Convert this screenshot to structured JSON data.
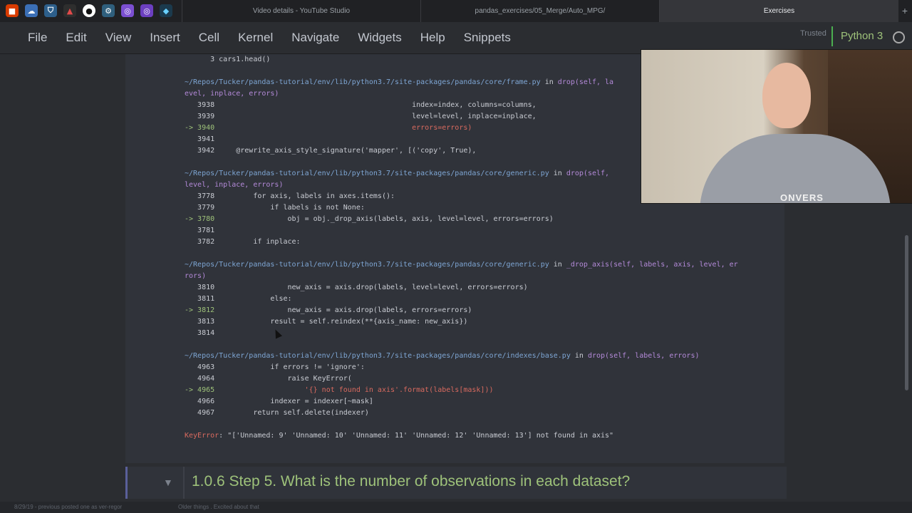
{
  "browser": {
    "tabs": [
      {
        "label": "Video details - YouTube Studio",
        "active": false
      },
      {
        "label": "pandas_exercises/05_Merge/Auto_MPG/",
        "active": false
      },
      {
        "label": "Exercises",
        "active": true
      }
    ],
    "extension_icons": [
      "office-icon",
      "cloud-icon",
      "shield-icon",
      "anaconda-icon",
      "github-icon",
      "python-icon",
      "notion-icon",
      "obsidian-icon",
      "diamond-icon"
    ],
    "new_tab": "+"
  },
  "menubar": {
    "items": [
      "File",
      "Edit",
      "View",
      "Insert",
      "Cell",
      "Kernel",
      "Navigate",
      "Widgets",
      "Help",
      "Snippets"
    ],
    "trusted": "Trusted",
    "kernel": "Python 3"
  },
  "traceback": {
    "line0": "      3 cars1.head()",
    "f1_path": "~/Repos/Tucker/pandas-tutorial/env/lib/python3.7/site-packages/pandas/core/frame.py",
    "f1_in": " in ",
    "f1_fn": "drop(self, la",
    "f1_cont": "evel, inplace, errors)",
    "f1_l1": "   3938                                              index=index, columns=columns,",
    "f1_l2": "   3939                                              level=level, inplace=inplace,",
    "f1_l3_arrow": "-> 3940",
    "f1_l3_code": "                                              errors=errors)",
    "f1_l4": "   3941",
    "f1_l5": "   3942     @rewrite_axis_style_signature('mapper', [('copy', True),",
    "f2_path": "~/Repos/Tucker/pandas-tutorial/env/lib/python3.7/site-packages/pandas/core/generic.py",
    "f2_in": " in ",
    "f2_fn": "drop(self,",
    "f2_cont": "level, inplace, errors)",
    "f2_l1": "   3778         for axis, labels in axes.items():",
    "f2_l2": "   3779             if labels is not None:",
    "f2_l3_arrow": "-> 3780",
    "f2_l3_code": "                 obj = obj._drop_axis(labels, axis, level=level, errors=errors)",
    "f2_l4": "   3781",
    "f2_l5": "   3782         if inplace:",
    "f3_path": "~/Repos/Tucker/pandas-tutorial/env/lib/python3.7/site-packages/pandas/core/generic.py",
    "f3_in": " in ",
    "f3_fn": "_drop_axis(self, labels, axis, level, er",
    "f3_cont": "rors)",
    "f3_l1": "   3810                 new_axis = axis.drop(labels, level=level, errors=errors)",
    "f3_l2": "   3811             else:",
    "f3_l3_arrow": "-> 3812",
    "f3_l3_code": "                 new_axis = axis.drop(labels, errors=errors)",
    "f3_l4": "   3813             result = self.reindex(**{axis_name: new_axis})",
    "f3_l5": "   3814",
    "f4_path": "~/Repos/Tucker/pandas-tutorial/env/lib/python3.7/site-packages/pandas/core/indexes/base.py",
    "f4_in": " in ",
    "f4_fn": "drop(self, labels, errors)",
    "f4_l1": "   4963             if errors != 'ignore':",
    "f4_l2": "   4964                 raise KeyError(",
    "f4_l3_arrow": "-> 4965",
    "f4_l3_code": "                     '{} not found in axis'.format(labels[mask]))",
    "f4_l4": "   4966             indexer = indexer[~mask]",
    "f4_l5": "   4967         return self.delete(indexer)",
    "error_name": "KeyError",
    "error_msg": ": \"['Unnamed: 9' 'Unnamed: 10' 'Unnamed: 11' 'Unnamed: 12' 'Unnamed: 13'] not found in axis\""
  },
  "markdown_cell": {
    "title": "1.0.6  Step 5. What is the number of observations in each dataset?"
  },
  "footer": {
    "left": "8/29/19 - previous posted one as ver-regor",
    "mid": "Older things . Excited about that"
  },
  "webcam": {
    "shirt_text": "ONVERS"
  }
}
